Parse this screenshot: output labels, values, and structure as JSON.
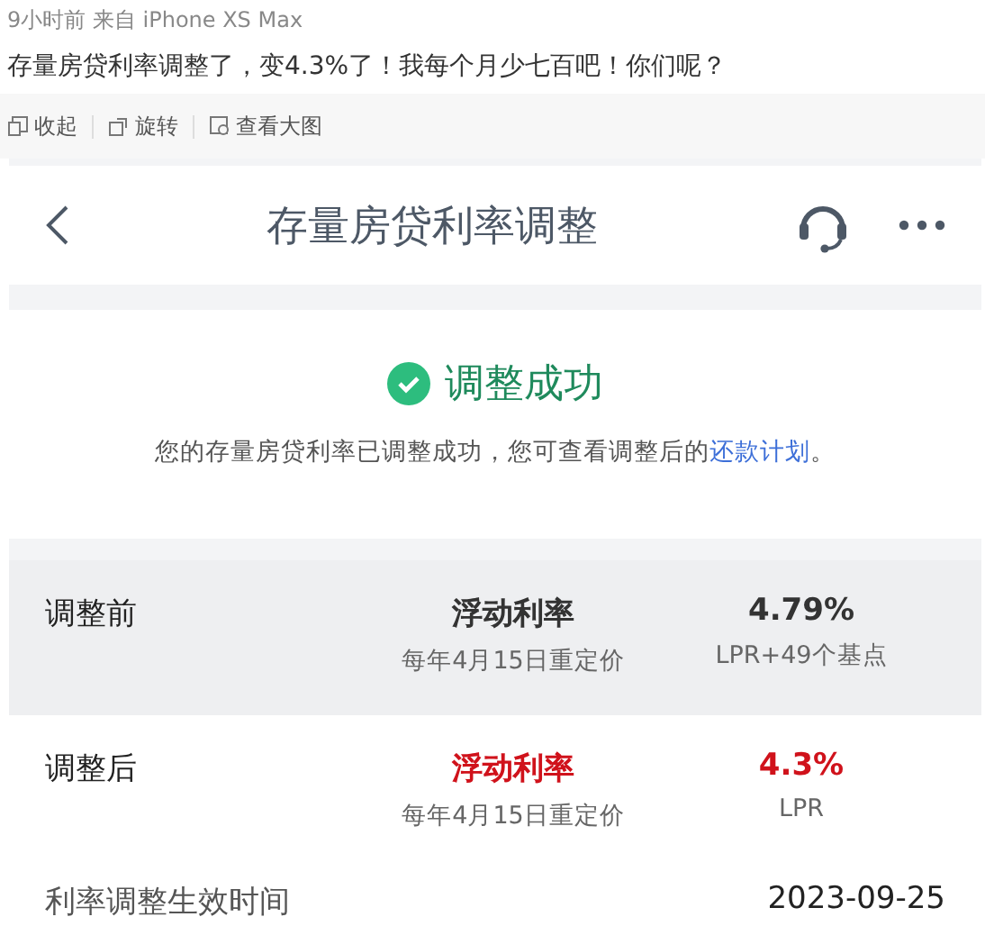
{
  "post": {
    "meta": "9小时前  来自 iPhone XS Max",
    "text": "存量房贷利率调整了，变4.3%了！我每个月少七百吧！你们呢？"
  },
  "actions": [
    {
      "kind": "collapse",
      "label": "收起"
    },
    {
      "kind": "rotate",
      "label": "旋转"
    },
    {
      "kind": "enlarge",
      "label": "查看大图"
    }
  ],
  "screen": {
    "title": "存量房贷利率调整",
    "success": {
      "heading": "调整成功",
      "message": "您的存量房贷利率已调整成功，您可查看调整后的",
      "link": "还款计划",
      "end": "。"
    },
    "rows": [
      {
        "kind": "before",
        "label": "调整前",
        "type": "浮动利率",
        "type_note": "每年4月15日重定价",
        "rate": "4.79%",
        "rate_note": "LPR+49个基点"
      },
      {
        "kind": "after",
        "label": "调整后",
        "type": "浮动利率",
        "type_note": "每年4月15日重定价",
        "rate": "4.3%",
        "rate_note": "LPR"
      }
    ],
    "effective": {
      "label": "利率调整生效时间",
      "value": "2023-09-25"
    }
  }
}
